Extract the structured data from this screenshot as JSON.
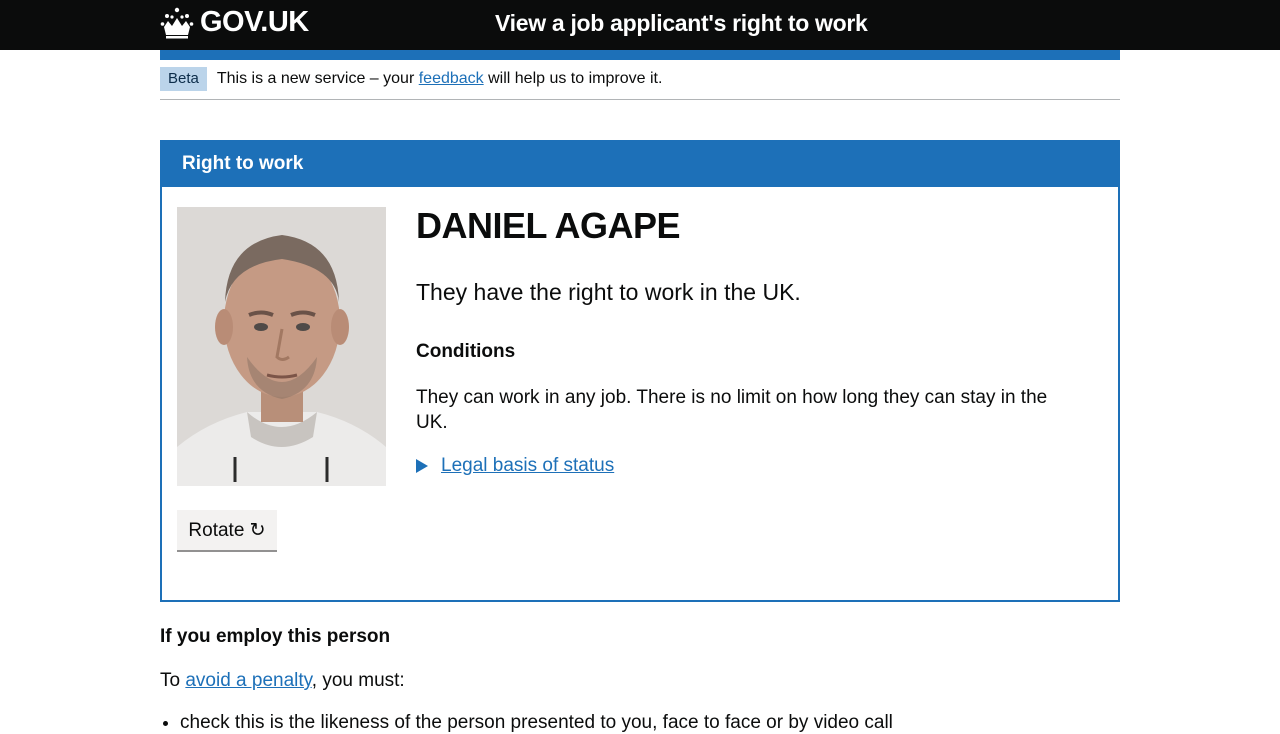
{
  "header": {
    "logo_text": "GOV.UK",
    "service_name": "View a job applicant's right to work"
  },
  "phase_banner": {
    "tag": "Beta",
    "text_before": "This is a new service – your ",
    "link": "feedback",
    "text_after": " will help us to improve it."
  },
  "panel": {
    "title": "Right to work",
    "name": "DANIEL AGAPE",
    "status": "They have the right to work in the UK.",
    "conditions_heading": "Conditions",
    "conditions_text": "They can work in any job. There is no limit on how long they can stay in the UK.",
    "details_summary": "Legal basis of status",
    "rotate_label": "Rotate ↻"
  },
  "employ": {
    "heading": "If you employ this person",
    "text_before": "To ",
    "link": "avoid a penalty",
    "text_after": ", you must:",
    "list_item": "check this is the likeness of the person presented to you, face to face or by video call"
  },
  "colors": {
    "brand_blue": "#1d70b8",
    "header_black": "#0b0c0c",
    "phase_tag_bg": "#bbd4ea"
  }
}
